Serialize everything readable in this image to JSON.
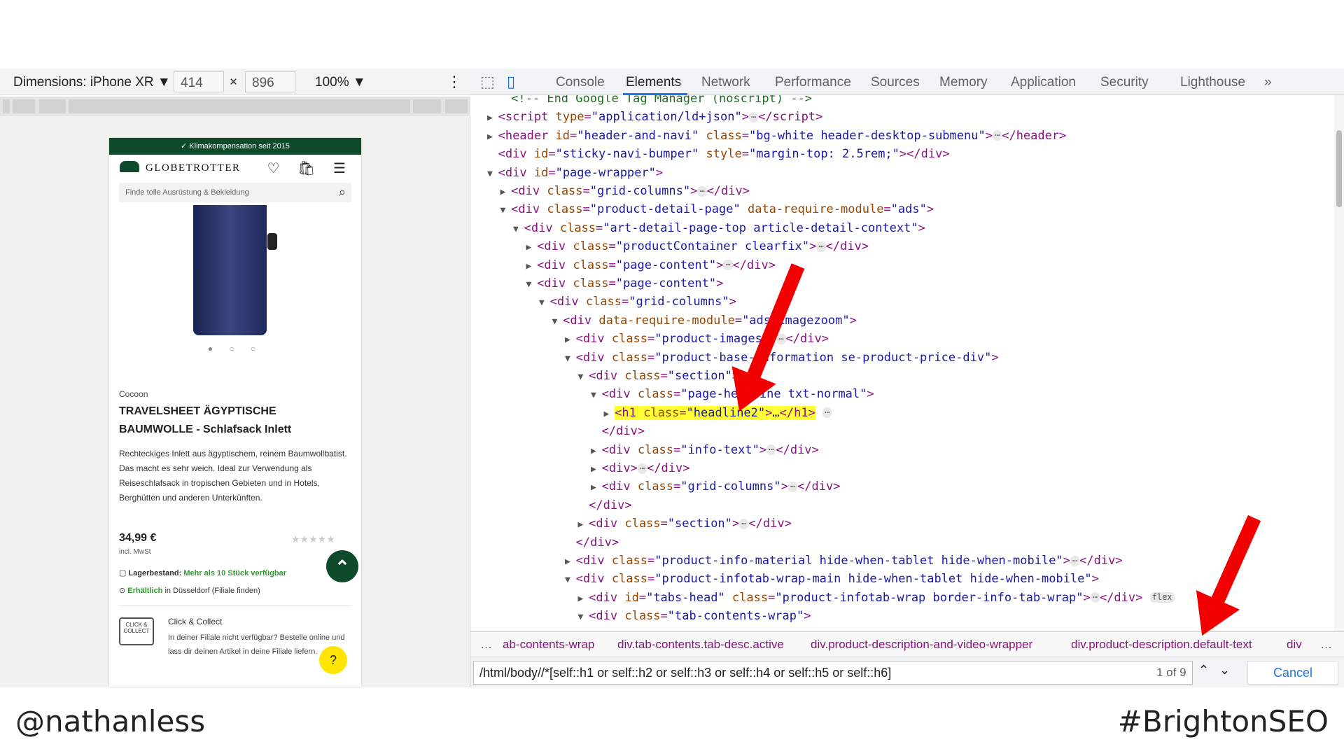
{
  "device_toolbar": {
    "dimensions_label": "Dimensions: iPhone XR ▼",
    "width": "414",
    "times": "×",
    "height": "896",
    "zoom": "100% ▼",
    "more": "⋮"
  },
  "phone": {
    "promo": "✓ Klimakompensation seit 2015",
    "logo": "GLOBETROTTER",
    "header_icons": "♡ 🛍 ☰",
    "search_placeholder": "Finde tolle Ausrüstung & Bekleidung",
    "search_icon": "⌕",
    "dots": "● ○ ○",
    "brand": "Cocoon",
    "title": "TRAVELSHEET ÄGYPTISCHE BAUMWOLLE - Schlafsack Inlett",
    "description": "Rechteckiges Inlett aus ägyptischem, reinem Baumwollbatist. Das macht es sehr weich. Ideal zur Verwendung als Reiseschlafsack in tropischen Gebieten und in Hotels, Berghütten und anderen Unterkünften.",
    "price": "34,99 €",
    "stars": "★★★★★",
    "vat": "incl. MwSt",
    "scroll_up": "⌃",
    "stock_label": "Lagerbestand:",
    "stock_value": "Mehr als 10 Stück verfügbar",
    "avail_green": "Erhältlich",
    "avail_text": " in Düsseldorf (Filiale finden)",
    "cc_icon": "CLICK & COLLECT",
    "cc_title": "Click & Collect",
    "cc_text": "In deiner Filiale nicht verfügbar? Bestelle online und lass dir deinen Artikel in deine Filiale liefern.",
    "help": "?"
  },
  "devtools": {
    "tabs": [
      "Console",
      "Elements",
      "Network",
      "Performance",
      "Sources",
      "Memory",
      "Application",
      "Security",
      "Lighthouse"
    ],
    "overflow": "»",
    "tree": [
      {
        "indent": 1,
        "arrow": "",
        "html": "<span class=\"cm\">&lt;!-- End Google Tag Manager (noscript) --&gt;</span>"
      },
      {
        "indent": 0,
        "arrow": "▶",
        "html": "<span class=\"tg\">&lt;script </span><span class=\"an\">type</span>=<span class=\"av\">\"application/ld+json\"</span><span class=\"tg\">&gt;</span><span class=\"ell\">⋯</span><span class=\"tg\">&lt;/script&gt;</span>"
      },
      {
        "indent": 0,
        "arrow": "▶",
        "html": "<span class=\"tg\">&lt;header </span><span class=\"an\">id</span>=<span class=\"av\">\"header-and-navi\"</span> <span class=\"an\">class</span>=<span class=\"av\">\"bg-white header-desktop-submenu\"</span><span class=\"tg\">&gt;</span><span class=\"ell\">⋯</span><span class=\"tg\">&lt;/header&gt;</span>"
      },
      {
        "indent": 0,
        "arrow": "",
        "html": "<span class=\"tg\">&lt;div </span><span class=\"an\">id</span>=<span class=\"av\">\"sticky-navi-bumper\"</span> <span class=\"an\">style</span>=<span class=\"av\">\"margin-top: 2.5rem;\"</span><span class=\"tg\">&gt;&lt;/div&gt;</span>"
      },
      {
        "indent": 0,
        "arrow": "▼",
        "html": "<span class=\"tg\">&lt;div </span><span class=\"an\">id</span>=<span class=\"av\">\"page-wrapper\"</span><span class=\"tg\">&gt;</span>"
      },
      {
        "indent": 1,
        "arrow": "▶",
        "html": "<span class=\"tg\">&lt;div </span><span class=\"an\">class</span>=<span class=\"av\">\"grid-columns\"</span><span class=\"tg\">&gt;</span><span class=\"ell\">⋯</span><span class=\"tg\">&lt;/div&gt;</span>"
      },
      {
        "indent": 1,
        "arrow": "▼",
        "html": "<span class=\"tg\">&lt;div </span><span class=\"an\">class</span>=<span class=\"av\">\"product-detail-page\"</span> <span class=\"an\">data-require-module</span>=<span class=\"av\">\"ads\"</span><span class=\"tg\">&gt;</span>"
      },
      {
        "indent": 2,
        "arrow": "▼",
        "html": "<span class=\"tg\">&lt;div </span><span class=\"an\">class</span>=<span class=\"av\">\"art-detail-page-top article-detail-context\"</span><span class=\"tg\">&gt;</span>"
      },
      {
        "indent": 3,
        "arrow": "▶",
        "html": "<span class=\"tg\">&lt;div </span><span class=\"an\">class</span>=<span class=\"av\">\"productContainer clearfix\"</span><span class=\"tg\">&gt;</span><span class=\"ell\">⋯</span><span class=\"tg\">&lt;/div&gt;</span>"
      },
      {
        "indent": 3,
        "arrow": "▶",
        "html": "<span class=\"tg\">&lt;div </span><span class=\"an\">class</span>=<span class=\"av\">\"page-content\"</span><span class=\"tg\">&gt;</span><span class=\"ell\">⋯</span><span class=\"tg\">&lt;/div&gt;</span>"
      },
      {
        "indent": 3,
        "arrow": "▼",
        "html": "<span class=\"tg\">&lt;div </span><span class=\"an\">class</span>=<span class=\"av\">\"page-content\"</span><span class=\"tg\">&gt;</span>"
      },
      {
        "indent": 4,
        "arrow": "▼",
        "html": "<span class=\"tg\">&lt;div </span><span class=\"an\">class</span>=<span class=\"av\">\"grid-columns\"</span><span class=\"tg\">&gt;</span>"
      },
      {
        "indent": 5,
        "arrow": "▼",
        "html": "<span class=\"tg\">&lt;div </span><span class=\"an\">data-require-module</span>=<span class=\"av\">\"ads imagezoom\"</span><span class=\"tg\">&gt;</span>"
      },
      {
        "indent": 6,
        "arrow": "▶",
        "html": "<span class=\"tg\">&lt;div </span><span class=\"an\">class</span>=<span class=\"av\">\"product-images\"</span><span class=\"tg\">&gt;</span><span class=\"ell\">⋯</span><span class=\"tg\">&lt;/div&gt;</span>"
      },
      {
        "indent": 6,
        "arrow": "▼",
        "html": "<span class=\"tg\">&lt;div </span><span class=\"an\">class</span>=<span class=\"av\">\"product-base-information se-product-price-div\"</span><span class=\"tg\">&gt;</span>"
      },
      {
        "indent": 7,
        "arrow": "▼",
        "html": "<span class=\"tg\">&lt;div </span><span class=\"an\">class</span>=<span class=\"av\">\"section\"</span><span class=\"tg\">&gt;</span>"
      },
      {
        "indent": 8,
        "arrow": "▼",
        "html": "<span class=\"tg\">&lt;div </span><span class=\"an\">class</span>=<span class=\"av\">\"page-headline txt-normal\"</span><span class=\"tg\">&gt;</span>"
      },
      {
        "indent": 9,
        "arrow": "▶",
        "html": "<span class=\"hl\"><span class=\"tg\">&lt;h1 </span><span class=\"an\">class</span>=<span class=\"av\">\"headline2\"</span><span class=\"tg\">&gt;</span><span class=\"tx\">…</span><span class=\"tg\">&lt;/h1&gt;</span></span> <span class=\"ell\">⋯</span>"
      },
      {
        "indent": 8,
        "arrow": "",
        "html": "<span class=\"tg\">&lt;/div&gt;</span>"
      },
      {
        "indent": 8,
        "arrow": "▶",
        "html": "<span class=\"tg\">&lt;div </span><span class=\"an\">class</span>=<span class=\"av\">\"info-text\"</span><span class=\"tg\">&gt;</span><span class=\"ell\">⋯</span><span class=\"tg\">&lt;/div&gt;</span>"
      },
      {
        "indent": 8,
        "arrow": "▶",
        "html": "<span class=\"tg\">&lt;div&gt;</span><span class=\"ell\">⋯</span><span class=\"tg\">&lt;/div&gt;</span>"
      },
      {
        "indent": 8,
        "arrow": "▶",
        "html": "<span class=\"tg\">&lt;div </span><span class=\"an\">class</span>=<span class=\"av\">\"grid-columns\"</span><span class=\"tg\">&gt;</span><span class=\"ell\">⋯</span><span class=\"tg\">&lt;/div&gt;</span>"
      },
      {
        "indent": 7,
        "arrow": "",
        "html": "<span class=\"tg\">&lt;/div&gt;</span>"
      },
      {
        "indent": 7,
        "arrow": "▶",
        "html": "<span class=\"tg\">&lt;div </span><span class=\"an\">class</span>=<span class=\"av\">\"section\"</span><span class=\"tg\">&gt;</span><span class=\"ell\">⋯</span><span class=\"tg\">&lt;/div&gt;</span>"
      },
      {
        "indent": 6,
        "arrow": "",
        "html": "<span class=\"tg\">&lt;/div&gt;</span>"
      },
      {
        "indent": 6,
        "arrow": "▶",
        "html": "<span class=\"tg\">&lt;div </span><span class=\"an\">class</span>=<span class=\"av\">\"product-info-material hide-when-tablet hide-when-mobile\"</span><span class=\"tg\">&gt;</span><span class=\"ell\">⋯</span><span class=\"tg\">&lt;/div&gt;</span>"
      },
      {
        "indent": 6,
        "arrow": "▼",
        "html": "<span class=\"tg\">&lt;div </span><span class=\"an\">class</span>=<span class=\"av\">\"product-infotab-wrap-main hide-when-tablet hide-when-mobile\"</span><span class=\"tg\">&gt;</span>"
      },
      {
        "indent": 7,
        "arrow": "▶",
        "html": "<span class=\"tg\">&lt;div </span><span class=\"an\">id</span>=<span class=\"av\">\"tabs-head\"</span> <span class=\"an\">class</span>=<span class=\"av\">\"product-infotab-wrap border-info-tab-wrap\"</span><span class=\"tg\">&gt;</span><span class=\"ell\">⋯</span><span class=\"tg\">&lt;/div&gt;</span> <span class=\"ell\">flex</span>"
      },
      {
        "indent": 7,
        "arrow": "▼",
        "html": "<span class=\"tg\">&lt;div </span><span class=\"an\">class</span>=<span class=\"av\">\"tab-contents-wrap\"</span><span class=\"tg\">&gt;</span>"
      }
    ],
    "breadcrumbs": [
      "…",
      "ab-contents-wrap",
      "div.tab-contents.tab-desc.active",
      "div.product-description-and-video-wrapper",
      "div.product-description.default-text",
      "div",
      "…"
    ],
    "find_query": "/html/body//*[self::h1 or self::h2 or self::h3 or self::h4 or self::h5 or self::h6]",
    "find_count": "1 of 9",
    "find_up": "⌃",
    "find_down": "⌄",
    "cancel": "Cancel"
  },
  "footer": {
    "left": "@nathanless",
    "right": "#BrightonSEO"
  },
  "colors": {
    "brand_green": "#0e4a2c",
    "highlight": "#ffff33",
    "arrow_red": "#f20000",
    "link_blue": "#1a73e8"
  }
}
